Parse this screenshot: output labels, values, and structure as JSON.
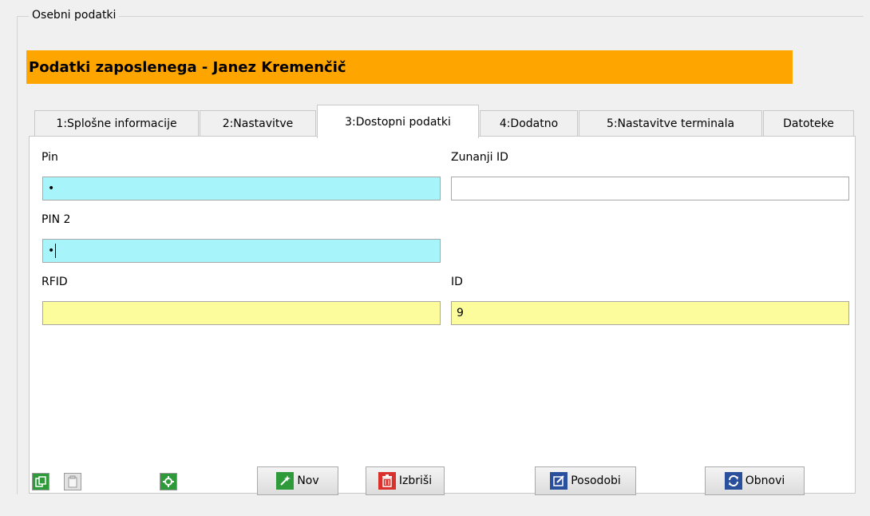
{
  "group": {
    "title": "Osebni podatki"
  },
  "banner": {
    "text": "Podatki zaposlenega - Janez Kremenčič",
    "color": "#ffa500"
  },
  "tabs": [
    {
      "label": "1:Splošne informacije"
    },
    {
      "label": "2:Nastavitve"
    },
    {
      "label": "3:Dostopni podatki",
      "active": true
    },
    {
      "label": "4:Dodatno"
    },
    {
      "label": "5:Nastavitve terminala"
    },
    {
      "label": "Datoteke"
    }
  ],
  "form": {
    "pin_label": "Pin",
    "pin_value": "•",
    "zunanji_label": "Zunanji ID",
    "zunanji_value": "",
    "pin2_label": "PIN 2",
    "pin2_value": "•",
    "rfid_label": "RFID",
    "rfid_value": "",
    "id_label": "ID",
    "id_value": "9"
  },
  "buttons": {
    "new_label": "Nov",
    "delete_label": "Izbriši",
    "update_label": "Posodobi",
    "refresh_label": "Obnovi"
  },
  "icons": [
    "copy-icon",
    "paste-icon",
    "settings-icon",
    "wand-icon",
    "trash-icon",
    "edit-icon",
    "refresh-icon"
  ]
}
